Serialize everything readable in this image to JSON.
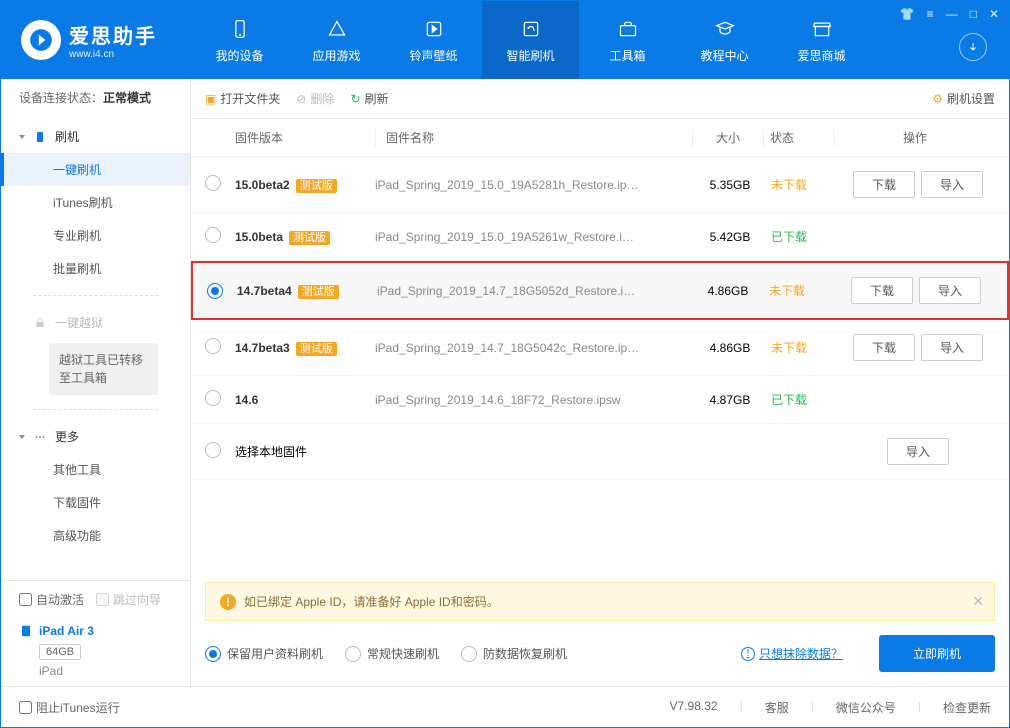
{
  "logo": {
    "title": "爱思助手",
    "url": "www.i4.cn"
  },
  "nav": [
    {
      "label": "我的设备"
    },
    {
      "label": "应用游戏"
    },
    {
      "label": "铃声壁纸"
    },
    {
      "label": "智能刷机"
    },
    {
      "label": "工具箱"
    },
    {
      "label": "教程中心"
    },
    {
      "label": "爱思商城"
    }
  ],
  "sidebar": {
    "status_label": "设备连接状态：",
    "status_value": "正常模式",
    "flash_head": "刷机",
    "flash_items": [
      "一键刷机",
      "iTunes刷机",
      "专业刷机",
      "批量刷机"
    ],
    "jailbreak_head": "一键越狱",
    "jailbreak_note": "越狱工具已转移至工具箱",
    "more_head": "更多",
    "more_items": [
      "其他工具",
      "下载固件",
      "高级功能"
    ],
    "auto_activate": "自动激活",
    "skip_guide": "跳过向导",
    "device_name": "iPad Air 3",
    "device_storage": "64GB",
    "device_type": "iPad"
  },
  "toolbar": {
    "open": "打开文件夹",
    "delete": "删除",
    "refresh": "刷新",
    "settings": "刷机设置"
  },
  "cols": {
    "ver": "固件版本",
    "name": "固件名称",
    "size": "大小",
    "stat": "状态",
    "ops": "操作"
  },
  "badge": "测试版",
  "rows": [
    {
      "ver": "15.0beta2",
      "name": "iPad_Spring_2019_15.0_19A5281h_Restore.ip…",
      "size": "5.35GB",
      "stat": "未下载",
      "dl": true,
      "imp": true
    },
    {
      "ver": "15.0beta",
      "name": "iPad_Spring_2019_15.0_19A5261w_Restore.i…",
      "size": "5.42GB",
      "stat": "已下载"
    },
    {
      "ver": "14.7beta4",
      "name": "iPad_Spring_2019_14.7_18G5052d_Restore.i…",
      "size": "4.86GB",
      "stat": "未下载",
      "dl": true,
      "imp": true,
      "selected": true
    },
    {
      "ver": "14.7beta3",
      "name": "iPad_Spring_2019_14.7_18G5042c_Restore.ip…",
      "size": "4.86GB",
      "stat": "未下载",
      "dl": true,
      "imp": true
    },
    {
      "ver": "14.6",
      "name": "iPad_Spring_2019_14.6_18F72_Restore.ipsw",
      "size": "4.87GB",
      "stat": "已下载",
      "nobadge": true
    }
  ],
  "local_row": "选择本地固件",
  "btn_download": "下载",
  "btn_import": "导入",
  "notice": "如已绑定 Apple ID，请准备好 Apple ID和密码。",
  "options": [
    "保留用户资料刷机",
    "常规快速刷机",
    "防数据恢复刷机"
  ],
  "erase_link": "只想抹除数据？",
  "flash_now": "立即刷机",
  "footer": {
    "block_itunes": "阻止iTunes运行",
    "version": "V7.98.32",
    "service": "客服",
    "wechat": "微信公众号",
    "update": "检查更新"
  }
}
